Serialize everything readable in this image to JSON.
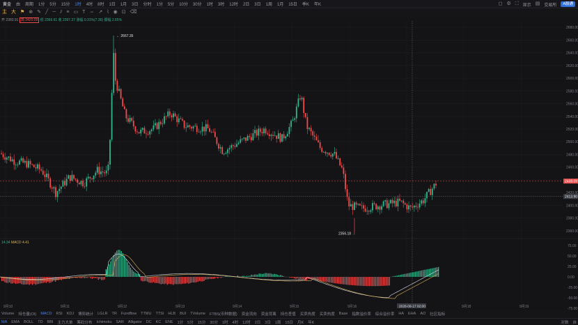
{
  "topbar": {
    "symbol": "黄金",
    "menu1": "由",
    "menu2": "周期",
    "timeframes": [
      "1分",
      "5分",
      "15分",
      "1时",
      "4时",
      "8时",
      "1日",
      "1月",
      "3日",
      "分时",
      "1分",
      "5分",
      "10分",
      "30分",
      "1时",
      "3时",
      "12时",
      "2日",
      "3日",
      "1周",
      "1月",
      "15日",
      "季K",
      "年K"
    ],
    "active_timeframe": "1时",
    "right_display": "显示",
    "right_btn": "交易所",
    "right_btn2": "A股通"
  },
  "legend": {
    "open": "开 2383.91",
    "high": "高 2420.09",
    "low": "低 2366.61",
    "close": "收 2397.27",
    "change": "涨幅 0.31%(7.36)",
    "amplitude": "振幅 2.65%"
  },
  "price_axis": {
    "ticks": [
      "2680.00",
      "2660.00",
      "2640.00",
      "2620.00",
      "2600.00",
      "2580.00",
      "2560.00",
      "2540.00",
      "2520.00",
      "2500.00",
      "2480.00",
      "2460.00",
      "2440.00",
      "2420.00",
      "2400.00",
      "2380.00",
      "2360.00"
    ],
    "current_price": "2438.09",
    "cross_price": "2413.90",
    "high_label": "2667.35",
    "low_label": "2356.18"
  },
  "macd": {
    "legend_dif": "14.34",
    "legend_macd": "MACD 4.41",
    "axis": [
      "75.00",
      "50.00",
      "25.00",
      "0.00",
      "-25.00",
      "-50.00",
      "-75.00"
    ]
  },
  "time_axis": [
    "9月10",
    "9月11",
    "9月12",
    "9月13",
    "9月14",
    "9月15",
    "9月16",
    "9月17",
    "9月18",
    "9月19"
  ],
  "crosshair_time": "2026-09-17 02:00",
  "indicators": [
    "Volume",
    "持仓量(OI)",
    "MACD",
    "RSI",
    "KDJ",
    "博弈统计",
    "LGLR",
    "TR",
    "Fundflow",
    "TTMU",
    "TTSI",
    "HLB",
    "BUI",
    "TVolume",
    "FTBS(币种数据)",
    "资金流向",
    "资金背离",
    "持仓差值",
    "买卖热度",
    "买卖热度",
    "Base",
    "指数溢价率",
    "综合溢价率",
    "HA",
    "EHA",
    "AO",
    "社区指标"
  ],
  "active_indicator": "MACD",
  "bottom_items": [
    "MA",
    "EMA",
    "BOLL",
    "TD",
    "BBI",
    "主力大单",
    "筹码分布",
    "Ichimoku",
    "SAR",
    "Alligator",
    "DC",
    "KC",
    "ENE"
  ],
  "bottom_timeframes": [
    "1分",
    "5分",
    "15分",
    "30分",
    "1时",
    "4时",
    "12时",
    "2日",
    "3日",
    "1周",
    "15日",
    "月K",
    "年K"
  ],
  "bottom_right": [
    "对数",
    "自"
  ]
}
